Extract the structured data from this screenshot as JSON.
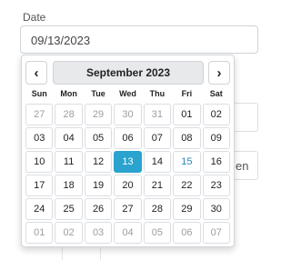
{
  "date_field": {
    "label": "Date",
    "value": "09/13/2023"
  },
  "background": {
    "partial_text": "en"
  },
  "datepicker": {
    "month_label": "September 2023",
    "prev_label": "‹",
    "next_label": "›",
    "weekdays": [
      "Sun",
      "Mon",
      "Tue",
      "Wed",
      "Thu",
      "Fri",
      "Sat"
    ],
    "days": [
      {
        "label": "27",
        "state": "muted"
      },
      {
        "label": "28",
        "state": "muted"
      },
      {
        "label": "29",
        "state": "muted"
      },
      {
        "label": "30",
        "state": "muted"
      },
      {
        "label": "31",
        "state": "muted"
      },
      {
        "label": "01",
        "state": ""
      },
      {
        "label": "02",
        "state": ""
      },
      {
        "label": "03",
        "state": ""
      },
      {
        "label": "04",
        "state": ""
      },
      {
        "label": "05",
        "state": ""
      },
      {
        "label": "06",
        "state": ""
      },
      {
        "label": "07",
        "state": ""
      },
      {
        "label": "08",
        "state": ""
      },
      {
        "label": "09",
        "state": ""
      },
      {
        "label": "10",
        "state": ""
      },
      {
        "label": "11",
        "state": ""
      },
      {
        "label": "12",
        "state": ""
      },
      {
        "label": "13",
        "state": "selected"
      },
      {
        "label": "14",
        "state": ""
      },
      {
        "label": "15",
        "state": "today"
      },
      {
        "label": "16",
        "state": ""
      },
      {
        "label": "17",
        "state": ""
      },
      {
        "label": "18",
        "state": ""
      },
      {
        "label": "19",
        "state": ""
      },
      {
        "label": "20",
        "state": ""
      },
      {
        "label": "21",
        "state": ""
      },
      {
        "label": "22",
        "state": ""
      },
      {
        "label": "23",
        "state": ""
      },
      {
        "label": "24",
        "state": ""
      },
      {
        "label": "25",
        "state": ""
      },
      {
        "label": "26",
        "state": ""
      },
      {
        "label": "27",
        "state": ""
      },
      {
        "label": "28",
        "state": ""
      },
      {
        "label": "29",
        "state": ""
      },
      {
        "label": "30",
        "state": ""
      },
      {
        "label": "01",
        "state": "muted"
      },
      {
        "label": "02",
        "state": "muted"
      },
      {
        "label": "03",
        "state": "muted"
      },
      {
        "label": "04",
        "state": "muted"
      },
      {
        "label": "05",
        "state": "muted"
      },
      {
        "label": "06",
        "state": "muted"
      },
      {
        "label": "07",
        "state": "muted"
      }
    ]
  },
  "colors": {
    "selected_bg": "#2aa3cf",
    "today_text": "#2a86b8",
    "header_bg": "#e7e9eb"
  }
}
